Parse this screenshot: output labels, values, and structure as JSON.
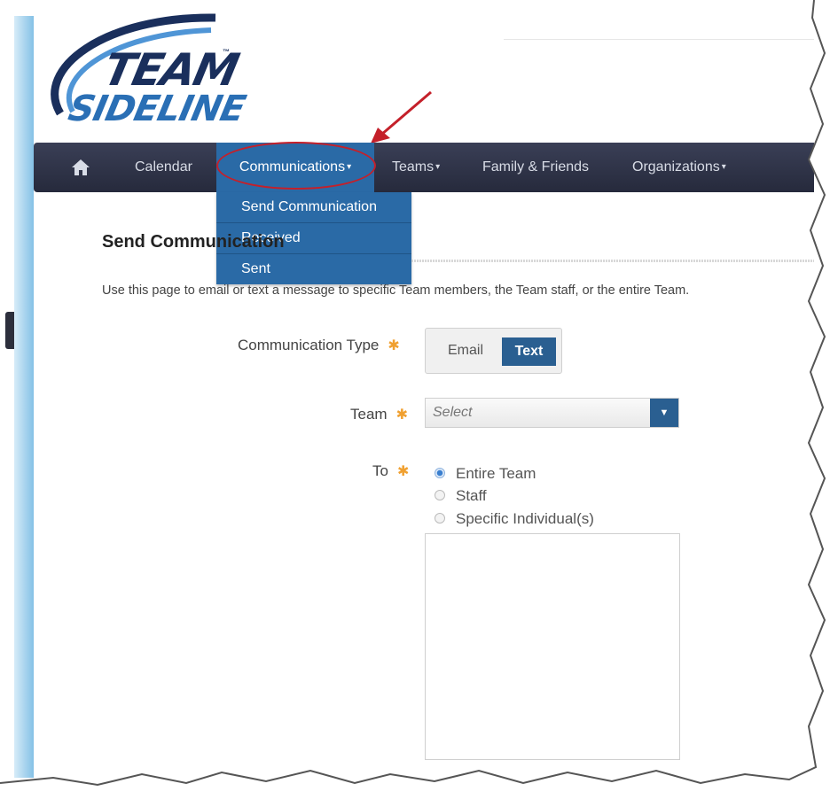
{
  "brand": {
    "logo_top": "TEAM",
    "logo_bottom": "SIDELINE",
    "trademark": "™"
  },
  "nav": {
    "home_icon": "home-icon",
    "items": [
      {
        "label": "Calendar"
      },
      {
        "label": "Communications"
      },
      {
        "label": "Teams"
      },
      {
        "label": "Family & Friends"
      },
      {
        "label": "Organizations"
      }
    ],
    "active_color": "#2a6aa6"
  },
  "dropdown": {
    "items": [
      {
        "label": "Send Communication"
      },
      {
        "label": "Received"
      },
      {
        "label": "Sent"
      }
    ]
  },
  "page": {
    "title": "Send Communication",
    "intro": "Use this page to email or text a message to specific Team members, the Team staff, or the entire Team."
  },
  "form": {
    "comm_type_label": "Communication Type",
    "comm_type_options": [
      "Email",
      "Text"
    ],
    "comm_type_selected": "Text",
    "team_label": "Team",
    "team_select_placeholder": "Select",
    "to_label": "To",
    "to_options": [
      {
        "label": "Entire Team",
        "checked": true
      },
      {
        "label": "Staff",
        "checked": false
      },
      {
        "label": "Specific Individual(s)",
        "checked": false
      }
    ],
    "required_marker": "✱"
  },
  "annotation": {
    "highlight_color": "#c4202a"
  }
}
